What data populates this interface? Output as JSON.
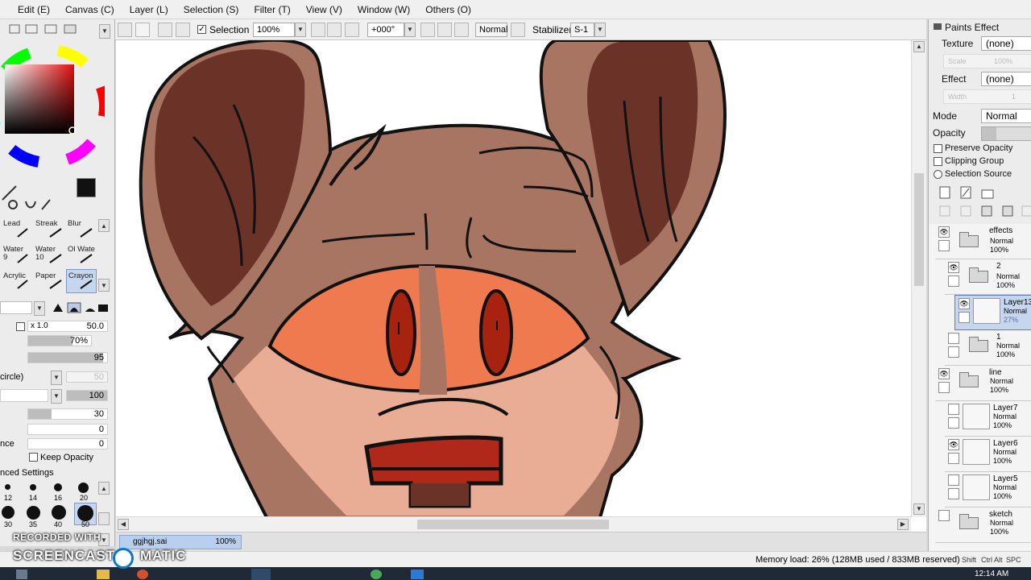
{
  "menu": [
    "Edit (E)",
    "Canvas (C)",
    "Layer (L)",
    "Selection (S)",
    "Filter (T)",
    "View (V)",
    "Window (W)",
    "Others (O)"
  ],
  "toolbar": {
    "selection_label": "Selection",
    "selection_checked": true,
    "zoom": "100%",
    "rotation": "+000°",
    "blend_mode": "Normal",
    "stabilizer_label": "Stabilizer",
    "stabilizer_value": "S-1"
  },
  "tool_panel": {
    "brushes": [
      {
        "label": "Lead",
        "num": ""
      },
      {
        "label": "Streak",
        "num": ""
      },
      {
        "label": "Blur",
        "num": ""
      },
      {
        "label": "Water",
        "num": "9"
      },
      {
        "label": "Water",
        "num": "10"
      },
      {
        "label": "Ol Wate",
        "num": ""
      },
      {
        "label": "Acrylic",
        "num": ""
      },
      {
        "label": "Paper",
        "num": ""
      },
      {
        "label": "Crayon",
        "num": ""
      }
    ],
    "selected_brush": "Crayon",
    "size_multiplier": "x 1.0",
    "size_value": "50.0",
    "min_size": "70%",
    "density": "95",
    "shape_label": "circle)",
    "shape_value": "50",
    "texture_value": "100",
    "blending": "30",
    "dilution": "0",
    "persistence_label": "nce",
    "persistence": "0",
    "keep_opacity_label": "Keep Opacity",
    "advanced_label": "nced Settings",
    "size_presets": [
      "12",
      "14",
      "16",
      "20",
      "30",
      "35",
      "40",
      "50"
    ]
  },
  "paints_effect": {
    "header": "Paints Effect",
    "texture_label": "Texture",
    "texture_value": "(none)",
    "texture_scale": "100%",
    "texture_scale_label": "Scale",
    "effect_label": "Effect",
    "effect_value": "(none)",
    "effect_width_label": "Width",
    "effect_width": "1"
  },
  "layer_props": {
    "mode_label": "Mode",
    "mode_value": "Normal",
    "opacity_label": "Opacity",
    "preserve_opacity": "Preserve Opacity",
    "clipping_group": "Clipping Group",
    "selection_source": "Selection Source"
  },
  "layers": [
    {
      "name": "effects",
      "mode": "Normal",
      "opacity": "100%",
      "type": "folder",
      "visible": true,
      "indent": 0
    },
    {
      "name": "2",
      "mode": "Normal",
      "opacity": "100%",
      "type": "folder",
      "visible": true,
      "indent": 1
    },
    {
      "name": "Layer13",
      "mode": "Normal",
      "opacity": "27%",
      "type": "layer",
      "visible": true,
      "indent": 2,
      "selected": true
    },
    {
      "name": "1",
      "mode": "Normal",
      "opacity": "100%",
      "type": "folder",
      "visible": false,
      "indent": 1
    },
    {
      "name": "line",
      "mode": "Normal",
      "opacity": "100%",
      "type": "folder",
      "visible": true,
      "indent": 0
    },
    {
      "name": "Layer7",
      "mode": "Normal",
      "opacity": "100%",
      "type": "layer",
      "visible": false,
      "indent": 1
    },
    {
      "name": "Layer6",
      "mode": "Normal",
      "opacity": "100%",
      "type": "layer",
      "visible": true,
      "indent": 1
    },
    {
      "name": "Layer5",
      "mode": "Normal",
      "opacity": "100%",
      "type": "layer",
      "visible": false,
      "indent": 1
    },
    {
      "name": "sketch",
      "mode": "Normal",
      "opacity": "100%",
      "type": "folder",
      "visible": false,
      "indent": 0
    }
  ],
  "file_tab": {
    "name": "ggjhgj.sai",
    "zoom": "100%"
  },
  "status": {
    "memory": "Memory load: 26% (128MB used / 833MB reserved)",
    "keys": [
      "Shift",
      "Ctrl",
      "Alt",
      "SPC"
    ]
  },
  "taskbar": {
    "time": "12:14 AM"
  },
  "watermark": {
    "line1": "RECORDED WITH",
    "line2": "SCREENCAST",
    "line3": "MATIC"
  },
  "colors": {
    "current_color": "#111111",
    "fur_dark": "#6b3228",
    "fur_mid": "#a97563",
    "muzzle": "#e8ad94",
    "mask": "#ef7a4f",
    "eye": "#a8230f",
    "mouth": "#b0281a"
  },
  "icons": [
    "color-wheel-icon",
    "eye-icon",
    "folder-icon",
    "new-layer-icon",
    "new-folder-icon",
    "trash-icon",
    "pen-icon",
    "eraser-icon",
    "rotate-icon",
    "flip-icon"
  ]
}
